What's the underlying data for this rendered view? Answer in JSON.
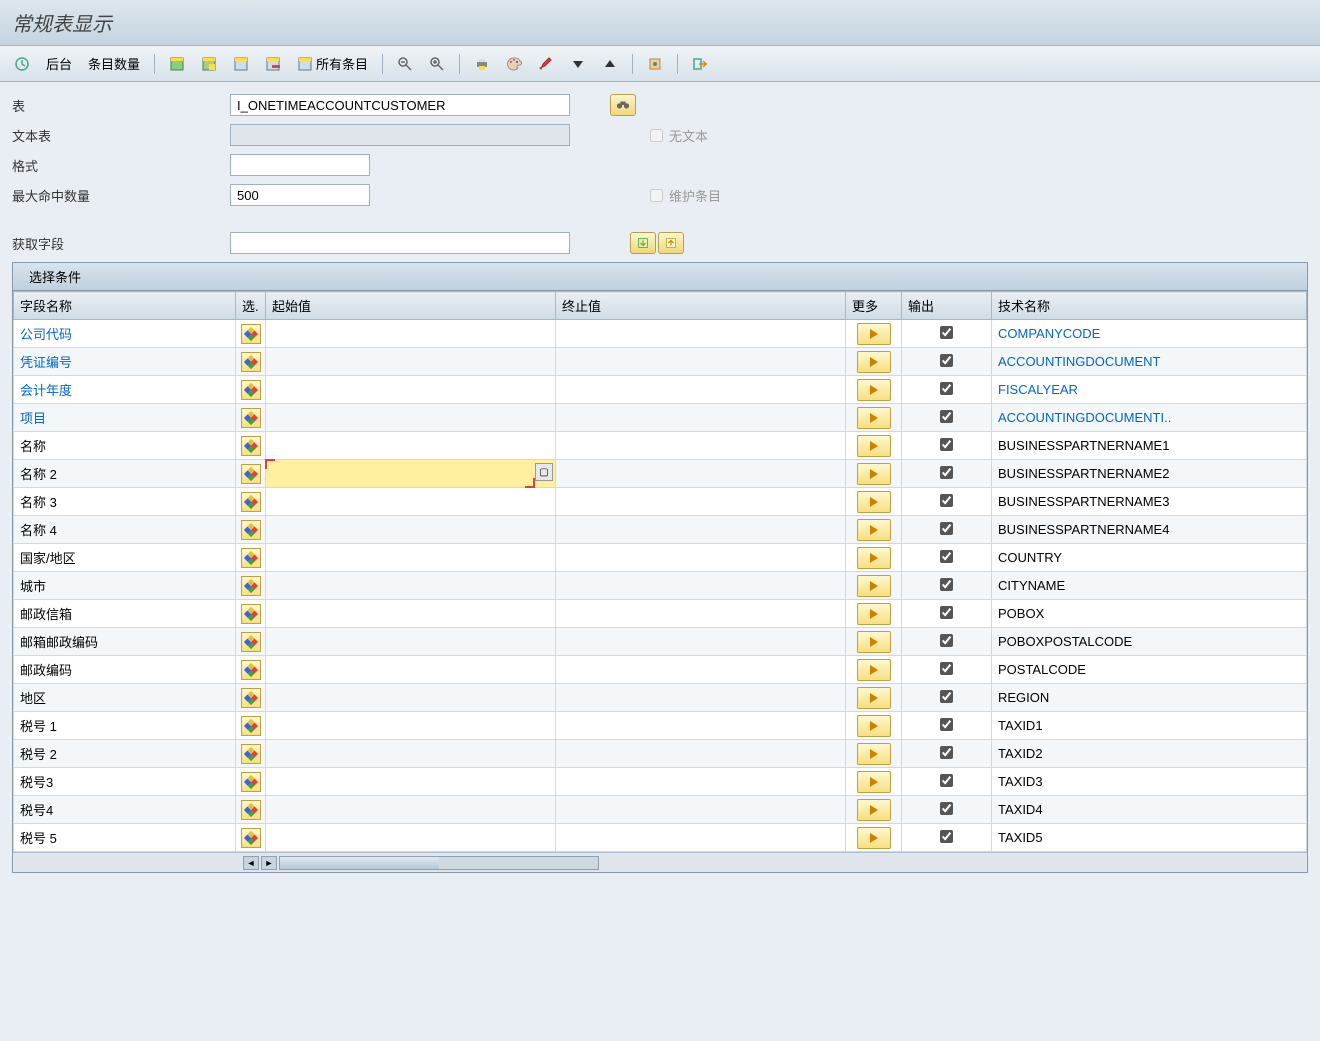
{
  "title": "常规表显示",
  "toolbar": {
    "background": "后台",
    "entry_count": "条目数量",
    "all_entries": "所有条目"
  },
  "form": {
    "table_label": "表",
    "table_value": "I_ONETIMEACCOUNTCUSTOMER",
    "text_table_label": "文本表",
    "text_table_value": "",
    "no_text_label": "无文本",
    "format_label": "格式",
    "format_value": "",
    "max_hits_label": "最大命中数量",
    "max_hits_value": "500",
    "maintain_label": "维护条目",
    "get_field_label": "获取字段",
    "get_field_value": ""
  },
  "grid": {
    "title": "选择条件",
    "cols": {
      "field_name": "字段名称",
      "sel": "选.",
      "from": "起始值",
      "to": "终止值",
      "more": "更多",
      "output": "输出",
      "tech": "技术名称"
    },
    "rows": [
      {
        "label": "公司代码",
        "tech": "COMPANYCODE",
        "key": true,
        "out": true
      },
      {
        "label": "凭证编号",
        "tech": "ACCOUNTINGDOCUMENT",
        "key": true,
        "out": true
      },
      {
        "label": "会计年度",
        "tech": "FISCALYEAR",
        "key": true,
        "out": true
      },
      {
        "label": "项目",
        "tech": "ACCOUNTINGDOCUMENTI..",
        "key": true,
        "out": true
      },
      {
        "label": "名称",
        "tech": "BUSINESSPARTNERNAME1",
        "key": false,
        "out": true
      },
      {
        "label": "名称 2",
        "tech": "BUSINESSPARTNERNAME2",
        "key": false,
        "out": true,
        "active": true
      },
      {
        "label": "名称 3",
        "tech": "BUSINESSPARTNERNAME3",
        "key": false,
        "out": true
      },
      {
        "label": "名称 4",
        "tech": "BUSINESSPARTNERNAME4",
        "key": false,
        "out": true
      },
      {
        "label": "国家/地区",
        "tech": "COUNTRY",
        "key": false,
        "out": true
      },
      {
        "label": "城市",
        "tech": "CITYNAME",
        "key": false,
        "out": true
      },
      {
        "label": "邮政信箱",
        "tech": "POBOX",
        "key": false,
        "out": true
      },
      {
        "label": "邮箱邮政编码",
        "tech": "POBOXPOSTALCODE",
        "key": false,
        "out": true
      },
      {
        "label": "邮政编码",
        "tech": "POSTALCODE",
        "key": false,
        "out": true
      },
      {
        "label": "地区",
        "tech": "REGION",
        "key": false,
        "out": true
      },
      {
        "label": "税号 1",
        "tech": "TAXID1",
        "key": false,
        "out": true
      },
      {
        "label": "税号 2",
        "tech": "TAXID2",
        "key": false,
        "out": true
      },
      {
        "label": "税号3",
        "tech": "TAXID3",
        "key": false,
        "out": true
      },
      {
        "label": "税号4",
        "tech": "TAXID4",
        "key": false,
        "out": true
      },
      {
        "label": "税号 5",
        "tech": "TAXID5",
        "key": false,
        "out": true
      }
    ]
  }
}
